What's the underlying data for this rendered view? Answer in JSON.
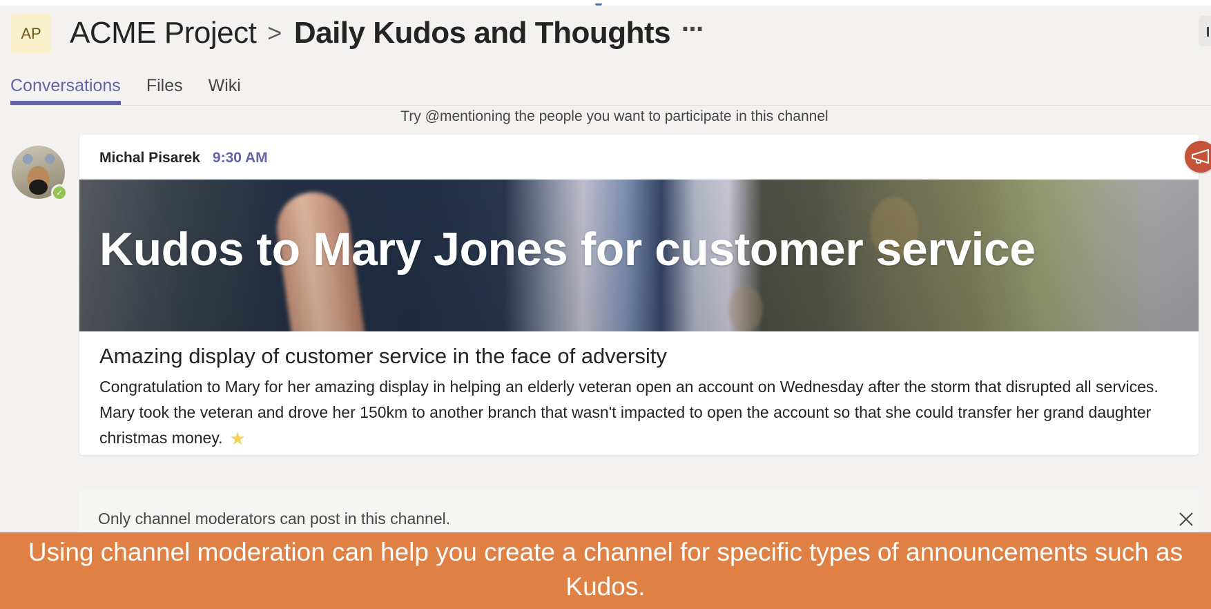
{
  "header": {
    "team_initials": "AP",
    "team_name": "ACME Project",
    "separator": ">",
    "channel_name": "Daily Kudos and Thoughts",
    "more_icon": "⋯"
  },
  "tabs": [
    {
      "label": "Conversations",
      "active": true
    },
    {
      "label": "Files",
      "active": false
    },
    {
      "label": "Wiki",
      "active": false
    }
  ],
  "hint_text": "Try @mentioning the people you want to participate in this channel",
  "message": {
    "author": "Michal Pisarek",
    "time": "9:30 AM",
    "presence": "available",
    "presence_icon": "✓",
    "banner_title": "Kudos to Mary Jones for customer service",
    "subtitle": "Amazing display of customer service in the face of adversity",
    "body": "Congratulation to Mary for her amazing display in helping an elderly veteran open an account on Wednesday after the storm that disrupted all services. Mary took the veteran and drove her 150km to another branch that wasn't impacted to open the account so that she could transfer her grand daughter christmas money.",
    "emoji": "★"
  },
  "compose_notice": {
    "text": "Only channel moderators can post in this channel."
  },
  "caption": "Using channel moderation can help you create a channel for specific types of announcements such as Kudos.",
  "colors": {
    "accent": "#6264a7",
    "announcement": "#c4533a",
    "caption_bg": "#df8145",
    "presence_available": "#92c353"
  }
}
